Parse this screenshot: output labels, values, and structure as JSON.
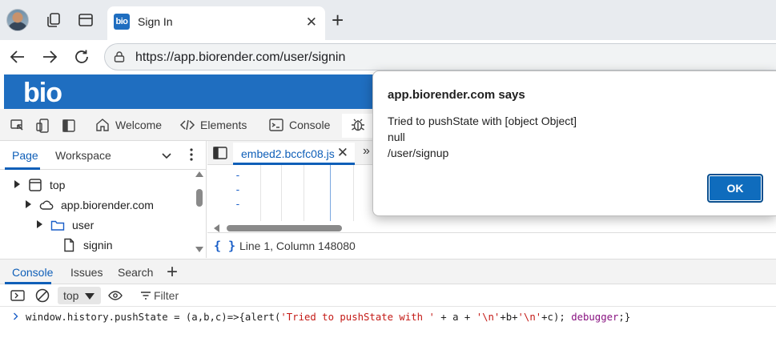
{
  "browser": {
    "active_tab": {
      "favicon_text": "bio",
      "title": "Sign In",
      "close": "✕"
    },
    "new_tab": "+",
    "address": {
      "url": "https://app.biorender.com/user/signin"
    }
  },
  "page": {
    "logo_text": "bio",
    "brand_color": "#1f6ec0"
  },
  "devtools": {
    "tabs": [
      {
        "label": "Welcome",
        "icon": "home-icon"
      },
      {
        "label": "Elements",
        "icon": "code-brackets-icon"
      },
      {
        "label": "Console",
        "icon": "console-icon"
      },
      {
        "label": "",
        "icon": "bug-icon"
      }
    ],
    "navigator": {
      "tabs": [
        "Page",
        "Workspace"
      ],
      "tree": [
        {
          "label": "top",
          "icon": "frame-icon"
        },
        {
          "label": "app.biorender.com",
          "icon": "cloud-icon"
        },
        {
          "label": "user",
          "icon": "folder-icon"
        },
        {
          "label": "signin",
          "icon": "file-icon"
        }
      ]
    },
    "editor": {
      "file_tab": "embed2.bccfc08.js",
      "close": "✕",
      "more": "»",
      "gutter_marks": [
        "-",
        "-",
        "-"
      ],
      "status_braces": "{ }",
      "cursor_position": "Line 1, Column 148080"
    },
    "drawer": {
      "tabs": [
        "Console",
        "Issues",
        "Search"
      ],
      "add": "+"
    },
    "console": {
      "context": "top",
      "filter_placeholder": "Filter",
      "input_parts": {
        "p1": "window.history.pushState = (a,b,c)=>{alert(",
        "s1": "'Tried to pushState with '",
        "p2": " + a + ",
        "s2": "'\\n'",
        "p3": "+b+",
        "s3": "'\\n'",
        "p4": "+c); ",
        "kw": "debugger",
        "p5": ";}"
      }
    }
  },
  "alert": {
    "title": "app.biorender.com says",
    "lines": [
      "Tried to pushState with [object Object]",
      "null",
      "/user/signup"
    ],
    "ok": "OK"
  }
}
